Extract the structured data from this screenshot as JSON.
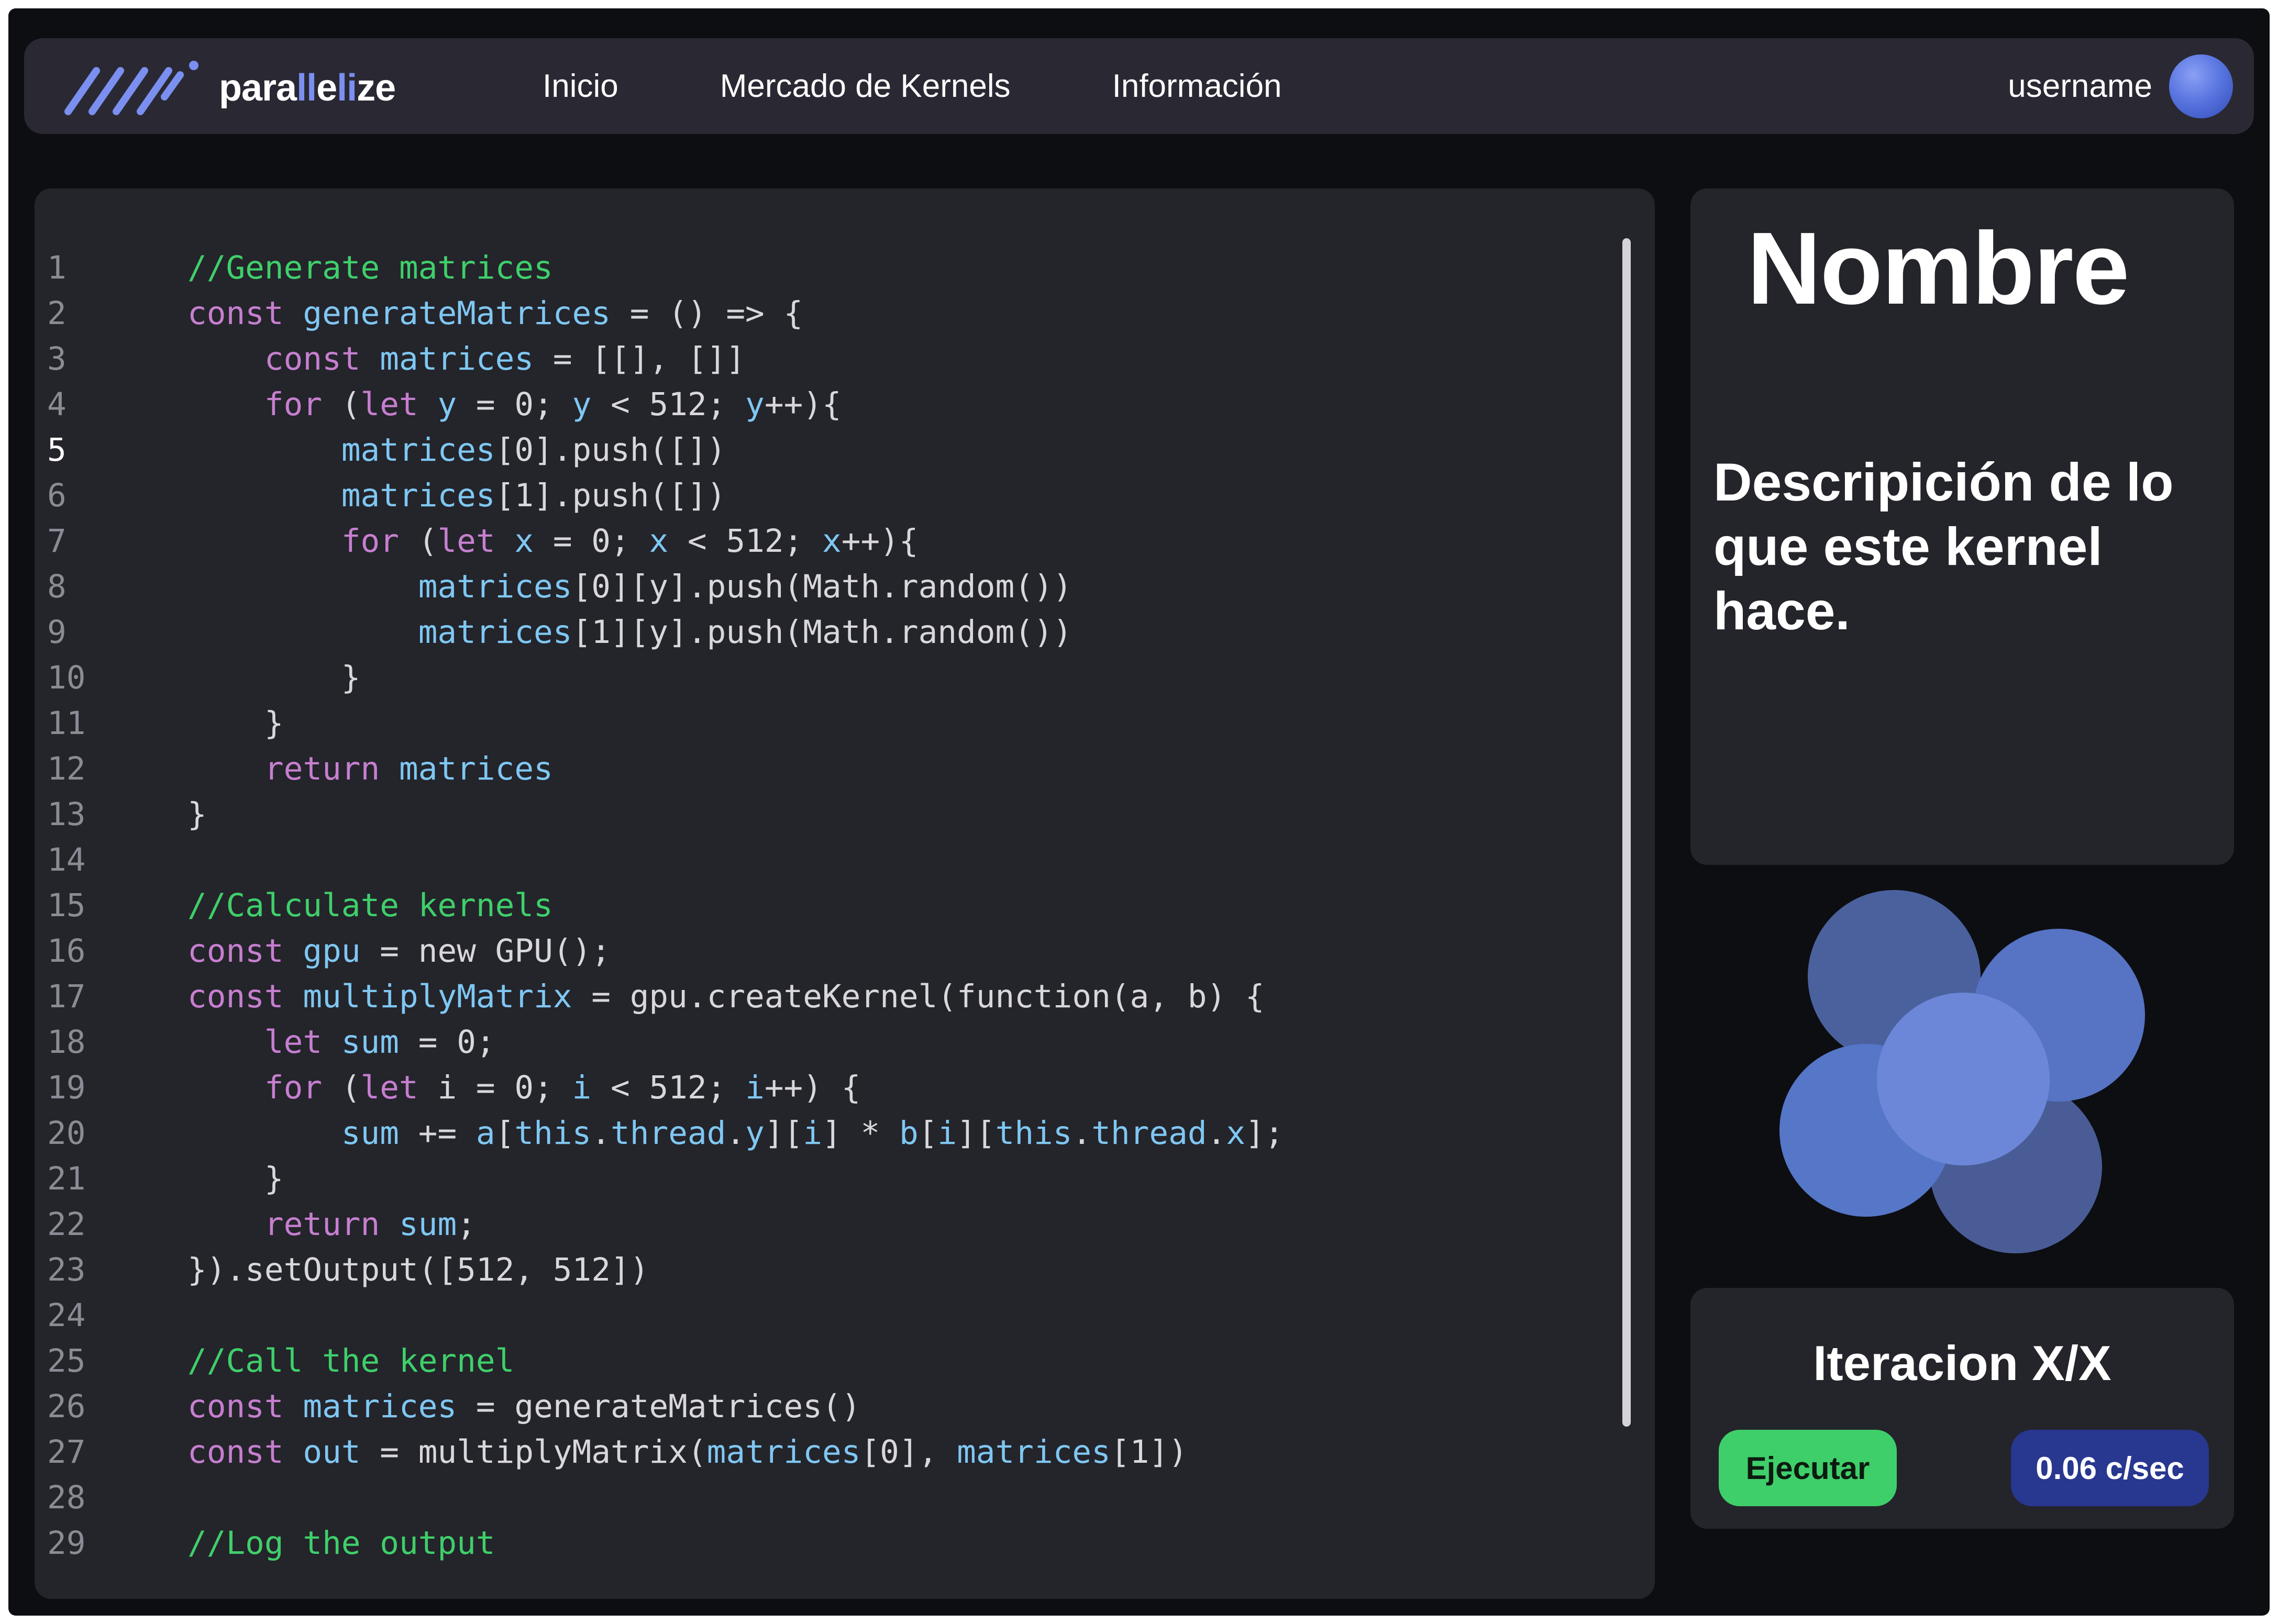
{
  "app": {
    "logo_prefix": "para",
    "logo_accent": "ll",
    "logo_middle": "e",
    "logo_accent2": "li",
    "logo_suffix": "ze",
    "accent_color": "#7b8ff0"
  },
  "nav": {
    "items": [
      {
        "label": "Inicio"
      },
      {
        "label": "Mercado de Kernels"
      },
      {
        "label": "Información"
      }
    ],
    "username": "username"
  },
  "editor": {
    "active_line": 5,
    "lines": [
      [
        [
          "//Generate matrices",
          "com"
        ]
      ],
      [
        [
          "const",
          "kw"
        ],
        [
          " ",
          "pl"
        ],
        [
          "generateMatrices",
          "var"
        ],
        [
          " = () => {",
          "pl"
        ]
      ],
      [
        [
          "    ",
          "pl"
        ],
        [
          "const",
          "kw"
        ],
        [
          " ",
          "pl"
        ],
        [
          "matrices",
          "var"
        ],
        [
          " = [[], []]",
          "pl"
        ]
      ],
      [
        [
          "    ",
          "pl"
        ],
        [
          "for",
          "kw"
        ],
        [
          " (",
          "pl"
        ],
        [
          "let",
          "kw"
        ],
        [
          " ",
          "pl"
        ],
        [
          "y",
          "var"
        ],
        [
          " = 0; ",
          "pl"
        ],
        [
          "y",
          "var"
        ],
        [
          " < 512; ",
          "pl"
        ],
        [
          "y",
          "var"
        ],
        [
          "++){",
          "pl"
        ]
      ],
      [
        [
          "        ",
          "pl"
        ],
        [
          "matrices",
          "var"
        ],
        [
          "[0].push([])",
          "pl"
        ]
      ],
      [
        [
          "        ",
          "pl"
        ],
        [
          "matrices",
          "var"
        ],
        [
          "[1].push([])",
          "pl"
        ]
      ],
      [
        [
          "        ",
          "pl"
        ],
        [
          "for",
          "kw"
        ],
        [
          " (",
          "pl"
        ],
        [
          "let",
          "kw"
        ],
        [
          " ",
          "pl"
        ],
        [
          "x",
          "var"
        ],
        [
          " = 0; ",
          "pl"
        ],
        [
          "x",
          "var"
        ],
        [
          " < 512; ",
          "pl"
        ],
        [
          "x",
          "var"
        ],
        [
          "++){",
          "pl"
        ]
      ],
      [
        [
          "            ",
          "pl"
        ],
        [
          "matrices",
          "var"
        ],
        [
          "[0][y].push(Math.random())",
          "pl"
        ]
      ],
      [
        [
          "            ",
          "pl"
        ],
        [
          "matrices",
          "var"
        ],
        [
          "[1][y].push(Math.random())",
          "pl"
        ]
      ],
      [
        [
          "        }",
          "pl"
        ]
      ],
      [
        [
          "    }",
          "pl"
        ]
      ],
      [
        [
          "    ",
          "pl"
        ],
        [
          "return",
          "kw"
        ],
        [
          " ",
          "pl"
        ],
        [
          "matrices",
          "var"
        ]
      ],
      [
        [
          "}",
          "pl"
        ]
      ],
      [
        [
          "",
          "pl"
        ]
      ],
      [
        [
          "//Calculate kernels",
          "com"
        ]
      ],
      [
        [
          "const",
          "kw"
        ],
        [
          " ",
          "pl"
        ],
        [
          "gpu",
          "var"
        ],
        [
          " = new GPU();",
          "pl"
        ]
      ],
      [
        [
          "const",
          "kw"
        ],
        [
          " ",
          "pl"
        ],
        [
          "multiplyMatrix",
          "var"
        ],
        [
          " = gpu.createKernel(function(a, b) {",
          "pl"
        ]
      ],
      [
        [
          "    ",
          "pl"
        ],
        [
          "let",
          "kw"
        ],
        [
          " ",
          "pl"
        ],
        [
          "sum",
          "var"
        ],
        [
          " = 0;",
          "pl"
        ]
      ],
      [
        [
          "    ",
          "pl"
        ],
        [
          "for",
          "kw"
        ],
        [
          " (",
          "pl"
        ],
        [
          "let",
          "kw"
        ],
        [
          " i = 0; ",
          "pl"
        ],
        [
          "i",
          "var"
        ],
        [
          " < 512; ",
          "pl"
        ],
        [
          "i",
          "var"
        ],
        [
          "++) {",
          "pl"
        ]
      ],
      [
        [
          "        ",
          "pl"
        ],
        [
          "sum",
          "var"
        ],
        [
          " += ",
          "pl"
        ],
        [
          "a",
          "var"
        ],
        [
          "[",
          "pl"
        ],
        [
          "this",
          "var"
        ],
        [
          ".",
          "pl"
        ],
        [
          "thread",
          "var"
        ],
        [
          ".",
          "pl"
        ],
        [
          "y",
          "var"
        ],
        [
          "][",
          "pl"
        ],
        [
          "i",
          "var"
        ],
        [
          "] * ",
          "pl"
        ],
        [
          "b",
          "var"
        ],
        [
          "[",
          "pl"
        ],
        [
          "i",
          "var"
        ],
        [
          "][",
          "pl"
        ],
        [
          "this",
          "var"
        ],
        [
          ".",
          "pl"
        ],
        [
          "thread",
          "var"
        ],
        [
          ".",
          "pl"
        ],
        [
          "x",
          "var"
        ],
        [
          "];",
          "pl"
        ]
      ],
      [
        [
          "    }",
          "pl"
        ]
      ],
      [
        [
          "    ",
          "pl"
        ],
        [
          "return",
          "kw"
        ],
        [
          " ",
          "pl"
        ],
        [
          "sum",
          "var"
        ],
        [
          ";",
          "pl"
        ]
      ],
      [
        [
          "}).setOutput([512, 512])",
          "pl"
        ]
      ],
      [
        [
          "",
          "pl"
        ]
      ],
      [
        [
          "//Call the kernel",
          "com"
        ]
      ],
      [
        [
          "const",
          "kw"
        ],
        [
          " ",
          "pl"
        ],
        [
          "matrices",
          "var"
        ],
        [
          " = generateMatrices()",
          "pl"
        ]
      ],
      [
        [
          "const",
          "kw"
        ],
        [
          " ",
          "pl"
        ],
        [
          "out",
          "var"
        ],
        [
          " = multiplyMatrix(",
          "pl"
        ],
        [
          "matrices",
          "var"
        ],
        [
          "[0], ",
          "pl"
        ],
        [
          "matrices",
          "var"
        ],
        [
          "[1])",
          "pl"
        ]
      ],
      [
        [
          "",
          "pl"
        ]
      ],
      [
        [
          "//Log the output",
          "com"
        ]
      ]
    ]
  },
  "info": {
    "title": "Nombre",
    "description": "Descripición de lo que este kernel hace."
  },
  "run": {
    "iteration_label": "Iteracion X/X",
    "execute_label": "Ejecutar",
    "rate_label": "0.06 c/sec",
    "execute_color": "#3fcf6a",
    "rate_color": "#28378f"
  }
}
